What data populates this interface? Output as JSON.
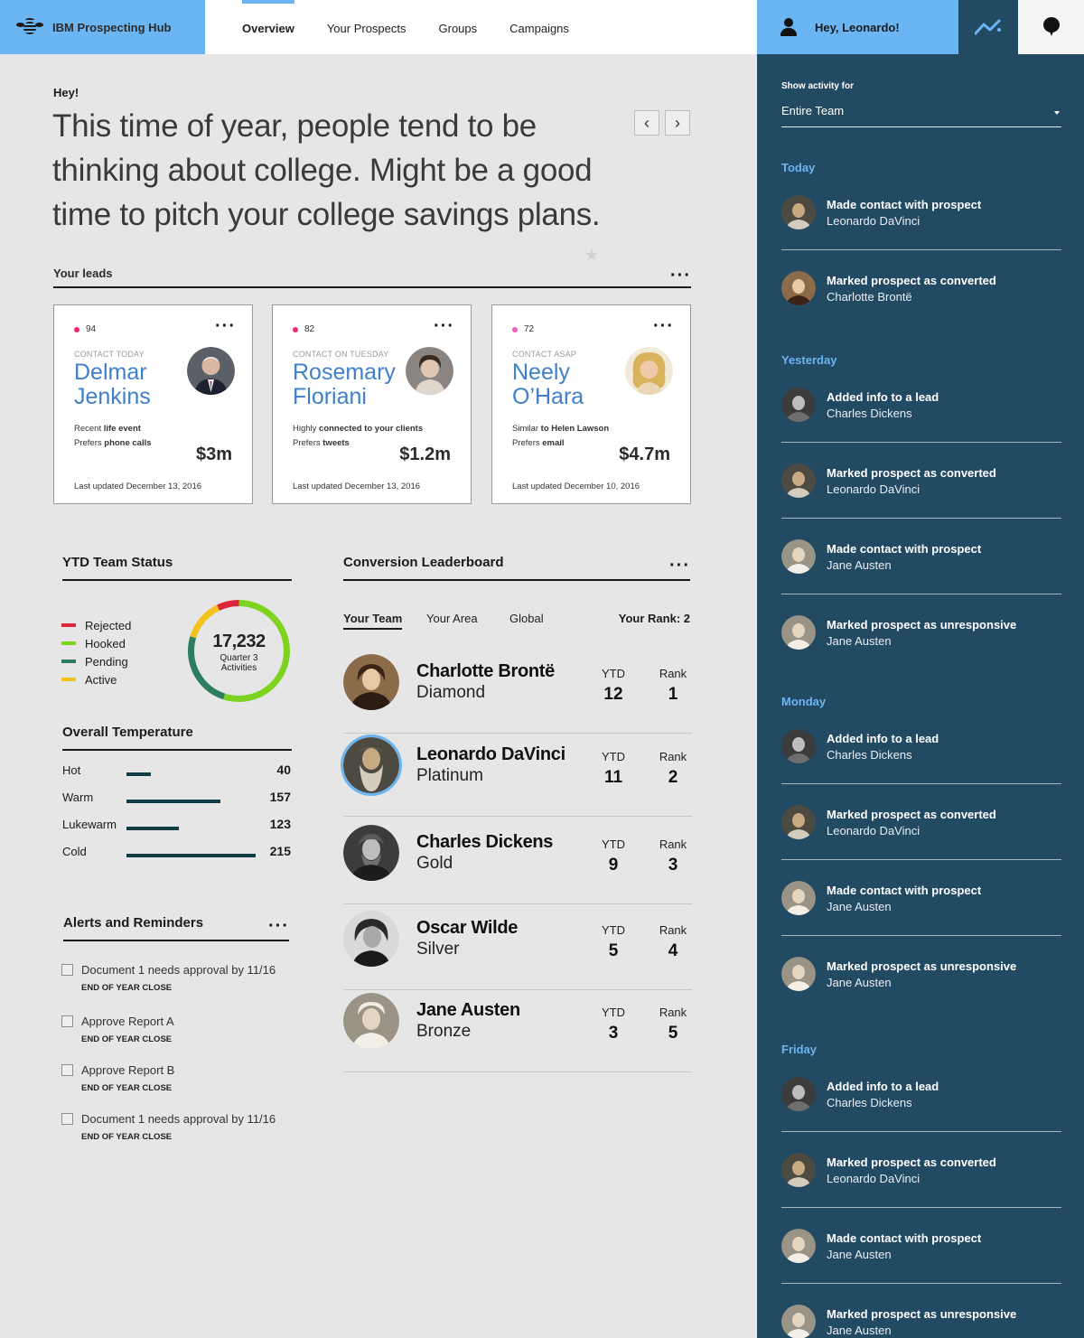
{
  "brand": {
    "name": "IBM Prospecting Hub"
  },
  "nav": {
    "tabs": [
      "Overview",
      "Your Prospects",
      "Groups",
      "Campaigns"
    ],
    "active": "Overview"
  },
  "user": {
    "greeting": "Hey, Leonardo!"
  },
  "hero": {
    "hey": "Hey!",
    "message": "This time of year, people tend to be thinking about college. Might be a good time to pitch your college savings plans."
  },
  "leads": {
    "title": "Your leads",
    "cards": [
      {
        "score": "94",
        "when": "CONTACT TODAY",
        "name": "Delmar Jenkins",
        "line1_pre": "Recent ",
        "line1_bold": "life event",
        "line2_pre": "Prefers ",
        "line2_bold": "phone calls",
        "amount": "$3m",
        "updated": "Last updated December 13, 2016"
      },
      {
        "score": "82",
        "when": "CONTACT ON TUESDAY",
        "name": "Rosemary Floriani",
        "line1_pre": "Highly ",
        "line1_bold": "connected to your clients",
        "line2_pre": "Prefers ",
        "line2_bold": "tweets",
        "amount": "$1.2m",
        "updated": "Last updated December 13, 2016"
      },
      {
        "score": "72",
        "when": "CONTACT ASAP",
        "name": "Neely O’Hara",
        "line1_pre": "Similar ",
        "line1_bold": "to Helen Lawson",
        "line2_pre": "Prefers ",
        "line2_bold": "email",
        "amount": "$4.7m",
        "updated": "Last updated December 10, 2016"
      }
    ]
  },
  "ytd": {
    "title": "YTD Team Status",
    "legend": [
      {
        "label": "Rejected",
        "color": "#e0243a"
      },
      {
        "label": "Hooked",
        "color": "#7ed321"
      },
      {
        "label": "Pending",
        "color": "#2e7d5e"
      },
      {
        "label": "Active",
        "color": "#f3c21b"
      }
    ],
    "total": "17,232",
    "total_label_1": "Quarter 3",
    "total_label_2": "Activities"
  },
  "temperature": {
    "title": "Overall Temperature",
    "rows": [
      {
        "label": "Hot",
        "value": 40
      },
      {
        "label": "Warm",
        "value": 157
      },
      {
        "label": "Lukewarm",
        "value": 123
      },
      {
        "label": "Cold",
        "value": 215
      }
    ]
  },
  "alerts": {
    "title": "Alerts and Reminders",
    "items": [
      {
        "title": "Document 1 needs approval by 11/16",
        "sub": "END OF YEAR CLOSE"
      },
      {
        "title": "Approve Report A",
        "sub": "END OF YEAR CLOSE"
      },
      {
        "title": "Approve Report B",
        "sub": "END OF YEAR CLOSE"
      },
      {
        "title": "Document 1 needs approval by 11/16",
        "sub": "END OF YEAR CLOSE"
      }
    ]
  },
  "leaderboard": {
    "title": "Conversion Leaderboard",
    "tabs": [
      "Your Team",
      "Your Area",
      "Global"
    ],
    "rank_text": "Your Rank: 2",
    "col_ytd": "YTD",
    "col_rank": "Rank",
    "rows": [
      {
        "name": "Charlotte Brontë",
        "tier": "Diamond",
        "ytd": "12",
        "rank": "1"
      },
      {
        "name": "Leonardo DaVinci",
        "tier": "Platinum",
        "ytd": "11",
        "rank": "2"
      },
      {
        "name": "Charles Dickens",
        "tier": "Gold",
        "ytd": "9",
        "rank": "3"
      },
      {
        "name": "Oscar Wilde",
        "tier": "Silver",
        "ytd": "5",
        "rank": "4"
      },
      {
        "name": "Jane Austen",
        "tier": "Bronze",
        "ytd": "3",
        "rank": "5"
      }
    ]
  },
  "activity": {
    "show_label": "Show activity for",
    "selected": "Entire Team",
    "days": [
      {
        "label": "Today",
        "items": [
          {
            "action": "Made contact with prospect",
            "person": "Leonardo DaVinci"
          },
          {
            "action": "Marked prospect as converted",
            "person": "Charlotte Brontë"
          }
        ]
      },
      {
        "label": "Yesterday",
        "items": [
          {
            "action": "Added info to a lead",
            "person": "Charles Dickens"
          },
          {
            "action": "Marked prospect as converted",
            "person": "Leonardo DaVinci"
          },
          {
            "action": "Made contact with prospect",
            "person": "Jane Austen"
          },
          {
            "action": "Marked prospect as unresponsive",
            "person": "Jane Austen"
          }
        ]
      },
      {
        "label": "Monday",
        "items": [
          {
            "action": "Added info to a lead",
            "person": "Charles Dickens"
          },
          {
            "action": "Marked prospect as converted",
            "person": "Leonardo DaVinci"
          },
          {
            "action": "Made contact with prospect",
            "person": "Jane Austen"
          },
          {
            "action": "Marked prospect as unresponsive",
            "person": "Jane Austen"
          }
        ]
      },
      {
        "label": "Friday",
        "items": [
          {
            "action": "Added info to a lead",
            "person": "Charles Dickens"
          },
          {
            "action": "Marked prospect as converted",
            "person": "Leonardo DaVinci"
          },
          {
            "action": "Made contact with prospect",
            "person": "Jane Austen"
          },
          {
            "action": "Marked prospect as unresponsive",
            "person": "Jane Austen"
          }
        ]
      }
    ]
  },
  "colors": {
    "accent": "#6cb5f3",
    "sidebar": "#234a63",
    "lead_name": "#3f80c8"
  }
}
